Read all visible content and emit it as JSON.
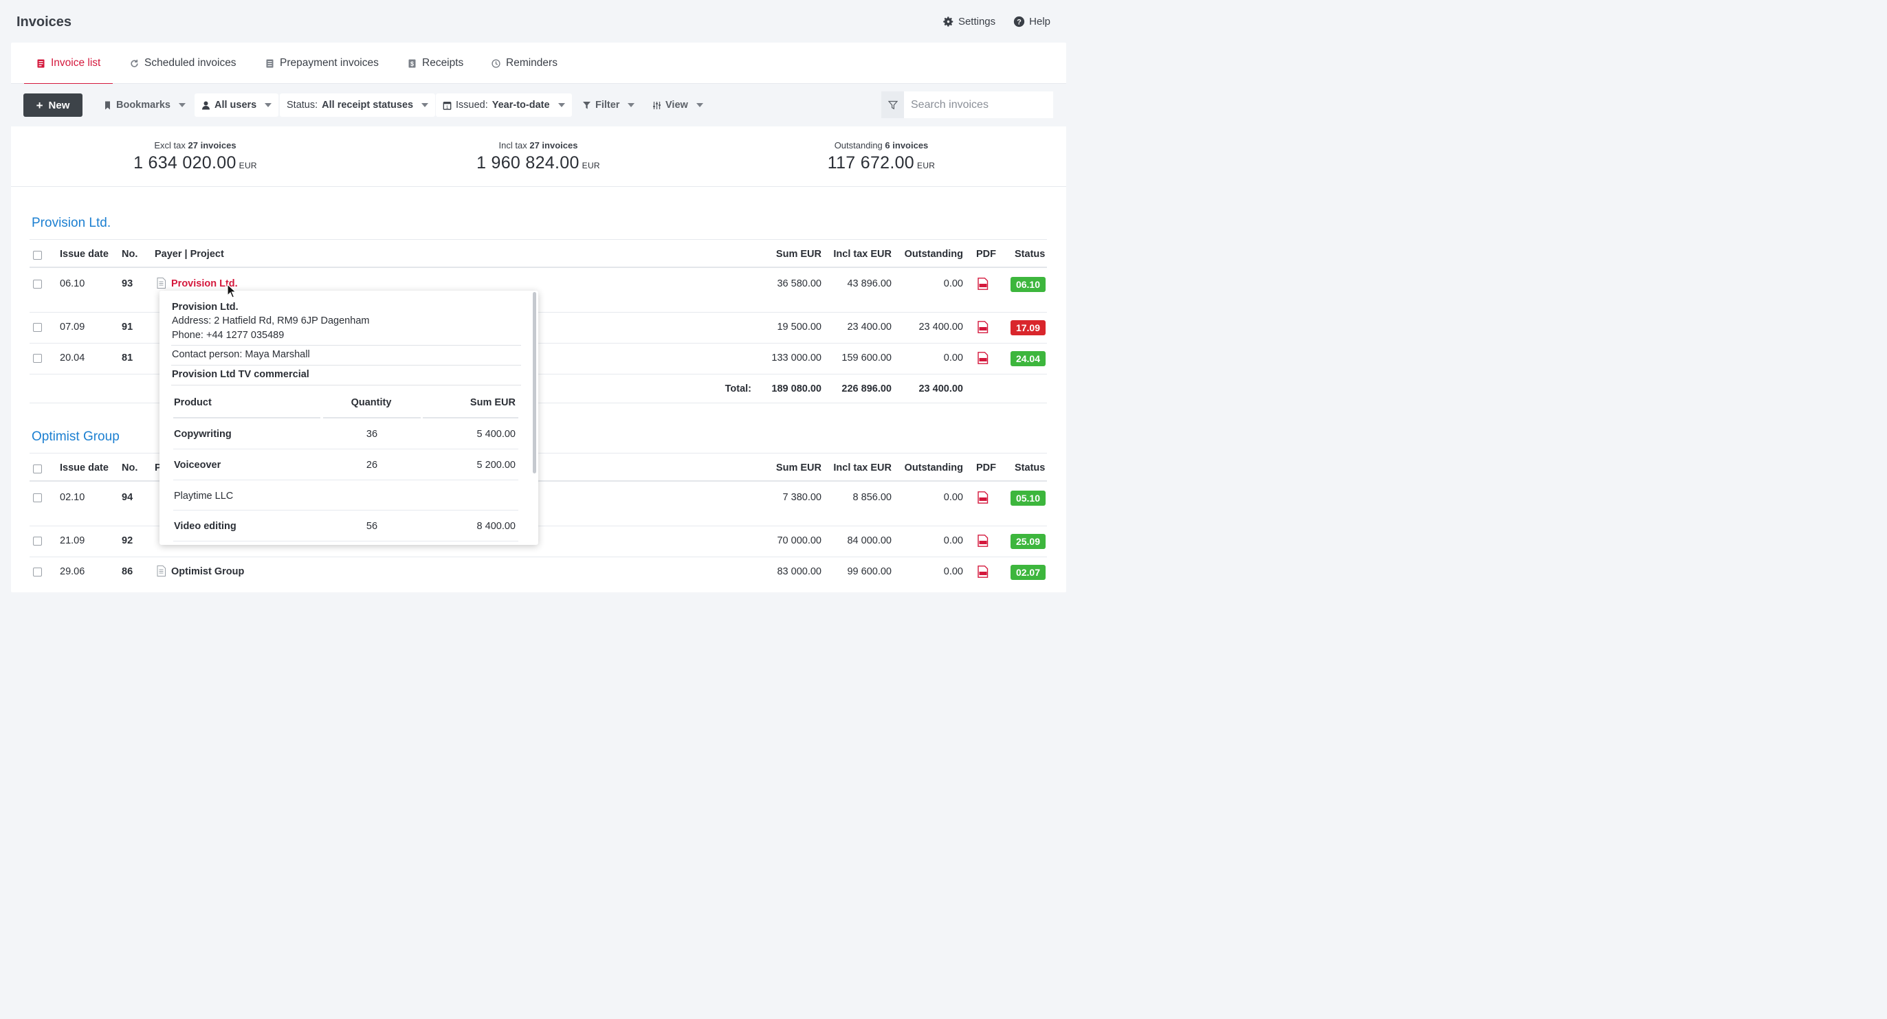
{
  "header": {
    "title": "Invoices",
    "settings_label": "Settings",
    "help_label": "Help"
  },
  "tabs": [
    {
      "label": "Invoice list",
      "icon": "invoice-icon",
      "active": true
    },
    {
      "label": "Scheduled invoices",
      "icon": "refresh-icon"
    },
    {
      "label": "Prepayment invoices",
      "icon": "document-icon"
    },
    {
      "label": "Receipts",
      "icon": "receipt-icon"
    },
    {
      "label": "Reminders",
      "icon": "clock-icon"
    }
  ],
  "toolbar": {
    "new_label": "New",
    "bookmarks_label": "Bookmarks",
    "users_label": "All users",
    "status_key": "Status:",
    "status_value": "All receipt statuses",
    "issued_key": "Issued:",
    "issued_value": "Year-to-date",
    "filter_label": "Filter",
    "view_label": "View",
    "search_placeholder": "Search invoices"
  },
  "summary": [
    {
      "label": "Excl tax",
      "count": "27 invoices",
      "value": "1 634 020.00",
      "currency": "EUR"
    },
    {
      "label": "Incl tax",
      "count": "27 invoices",
      "value": "1 960 824.00",
      "currency": "EUR"
    },
    {
      "label": "Outstanding",
      "count": "6 invoices",
      "value": "117 672.00",
      "currency": "EUR"
    }
  ],
  "columns": {
    "issue_date": "Issue date",
    "no": "No.",
    "payer_project": "Payer | Project",
    "sum": "Sum EUR",
    "incl_tax": "Incl tax EUR",
    "outstanding": "Outstanding",
    "pdf": "PDF",
    "status": "Status"
  },
  "groups": [
    {
      "name": "Provision Ltd.",
      "rows": [
        {
          "date": "06.10",
          "no": "93",
          "payer": "Provision Ltd.",
          "sum": "36 580.00",
          "incl": "43 896.00",
          "outstanding": "0.00",
          "status": "06.10",
          "status_color": "#3db63d"
        },
        {
          "date": "07.09",
          "no": "91",
          "payer": "",
          "sum": "19 500.00",
          "incl": "23 400.00",
          "outstanding": "23 400.00",
          "status": "17.09",
          "status_color": "#d9262c"
        },
        {
          "date": "20.04",
          "no": "81",
          "payer": "",
          "sum": "133 000.00",
          "incl": "159 600.00",
          "outstanding": "0.00",
          "status": "24.04",
          "status_color": "#3db63d"
        }
      ],
      "total_label": "Total:",
      "total_sum": "189 080.00",
      "total_incl": "226 896.00",
      "total_outstanding": "23 400.00"
    },
    {
      "name": "Optimist Group",
      "rows": [
        {
          "date": "02.10",
          "no": "94",
          "payer": "",
          "sum": "7 380.00",
          "incl": "8 856.00",
          "outstanding": "0.00",
          "status": "05.10",
          "status_color": "#3db63d"
        },
        {
          "date": "21.09",
          "no": "92",
          "payer": "",
          "sum": "70 000.00",
          "incl": "84 000.00",
          "outstanding": "0.00",
          "status": "25.09",
          "status_color": "#3db63d"
        },
        {
          "date": "29.06",
          "no": "86",
          "payer": "Optimist Group",
          "sum": "83 000.00",
          "incl": "99 600.00",
          "outstanding": "0.00",
          "status": "02.07",
          "status_color": "#3db63d"
        }
      ]
    }
  ],
  "popover": {
    "company": "Provision Ltd.",
    "address": "Address: 2 Hatfield Rd, RM9 6JP Dagenham",
    "phone": "Phone: +44 1277 035489",
    "contact": "Contact person: Maya Marshall",
    "project": "Provision Ltd TV commercial",
    "th_product": "Product",
    "th_quantity": "Quantity",
    "th_sum": "Sum EUR",
    "items": [
      {
        "product": "Copywriting",
        "quantity": "36",
        "sum": "5 400.00",
        "bold": true
      },
      {
        "product": "Voiceover",
        "quantity": "26",
        "sum": "5 200.00",
        "bold": true
      },
      {
        "product": "Playtime LLC",
        "quantity": "",
        "sum": "",
        "bold": false
      },
      {
        "product": "Video editing",
        "quantity": "56",
        "sum": "8 400.00",
        "bold": true
      }
    ]
  },
  "colors": {
    "accent": "#d4183c",
    "link_blue": "#1b7fd1",
    "status_green": "#3db63d",
    "status_red": "#d9262c"
  }
}
